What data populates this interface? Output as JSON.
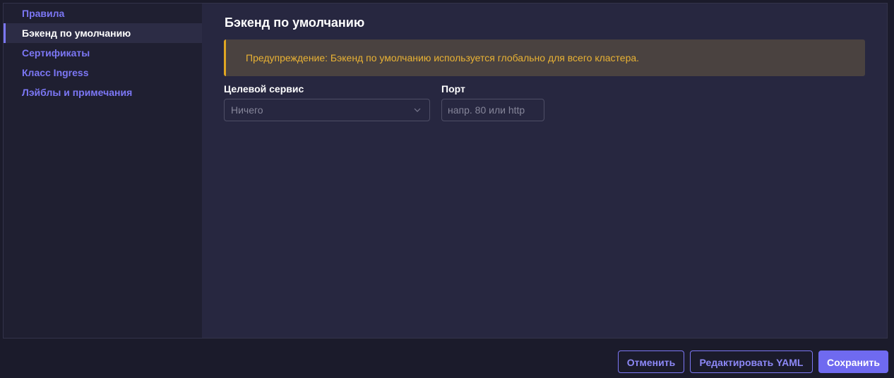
{
  "sidebar": {
    "items": [
      {
        "label": "Правила",
        "active": false
      },
      {
        "label": "Бэкенд по умолчанию",
        "active": true
      },
      {
        "label": "Сертификаты",
        "active": false
      },
      {
        "label": "Класс Ingress",
        "active": false
      },
      {
        "label": "Лэйблы и примечания",
        "active": false
      }
    ]
  },
  "main": {
    "title": "Бэкенд по умолчанию",
    "warning": "Предупреждение: Бэкенд по умолчанию используется глобально для всего кластера.",
    "target_service": {
      "label": "Целевой сервис",
      "value": "Ничего"
    },
    "port": {
      "label": "Порт",
      "value": "",
      "placeholder": "напр. 80 или http"
    }
  },
  "footer": {
    "cancel_label": "Отменить",
    "edit_yaml_label": "Редактировать YAML",
    "save_label": "Сохранить"
  },
  "colors": {
    "accent": "#7c77f5",
    "warning_text": "#e9b234",
    "warning_border": "#e0a622",
    "background": "#272740",
    "sidebar_background": "#1f1f31"
  },
  "icons": {
    "select_chevron": "chevron-down-icon"
  }
}
